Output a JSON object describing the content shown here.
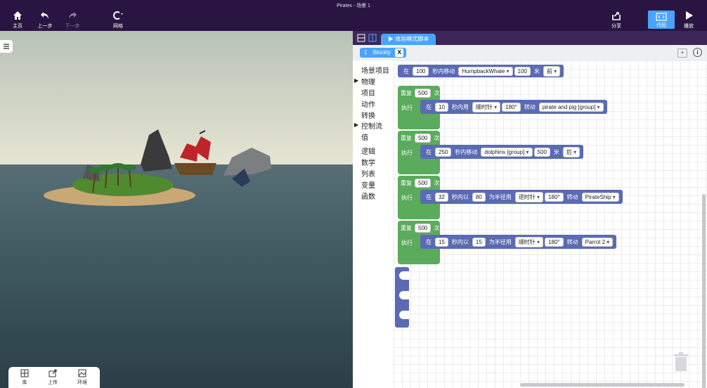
{
  "app": {
    "title": "Pirates - 场景 1"
  },
  "toolbar": {
    "home": "主页",
    "undo": "上一步",
    "redo": "下一步",
    "grid": "网格",
    "share": "分享",
    "code": "代码",
    "play": "播放"
  },
  "scene_tools": {
    "library": "库",
    "upload": "上传",
    "environment": "环境"
  },
  "editor": {
    "tab_label": "体验模式脚本",
    "file_index": "1",
    "file_name": "Blockly",
    "close_glyph": "X",
    "add_glyph": "+",
    "info_glyph": "i"
  },
  "categories": [
    "场景项目",
    "物理",
    "项目",
    "动作",
    "转换",
    "控制流",
    "值",
    "逻辑",
    "数学",
    "列表",
    "变量",
    "函数"
  ],
  "blocks": {
    "top": {
      "word_at": "在",
      "secs": "100",
      "move_label": "秒内移动",
      "target": "HumpbackWhale",
      "distance": "100",
      "unit": "米",
      "direction": "前"
    },
    "loops": [
      {
        "repeat": "重复",
        "count": "500",
        "times": "次",
        "exec": "执行",
        "at": "在",
        "secs": "10",
        "action": "秒内用",
        "dir": "顺时针",
        "deg": "180°",
        "verb": "转动",
        "target": "pirate and pig [group]"
      },
      {
        "repeat": "重复",
        "count": "500",
        "times": "次",
        "exec": "执行",
        "at": "在",
        "secs": "250",
        "action": "秒内移动",
        "target": "dolphins [group]",
        "distance": "500",
        "unit": "米",
        "direction": "后"
      },
      {
        "repeat": "重复",
        "count": "500",
        "times": "次",
        "exec": "执行",
        "at": "在",
        "secs": "32",
        "action": "秒内以",
        "radius": "80",
        "radius_label": "为半径用",
        "dir": "逆时针",
        "deg": "180°",
        "verb": "转动",
        "target": "PirateShip"
      },
      {
        "repeat": "重复",
        "count": "500",
        "times": "次",
        "exec": "执行",
        "at": "在",
        "secs": "15",
        "action": "秒内以",
        "radius": "15",
        "radius_label": "为半径用",
        "dir": "顺时针",
        "deg": "180°",
        "verb": "转动",
        "target": "Parrot 2"
      }
    ]
  }
}
